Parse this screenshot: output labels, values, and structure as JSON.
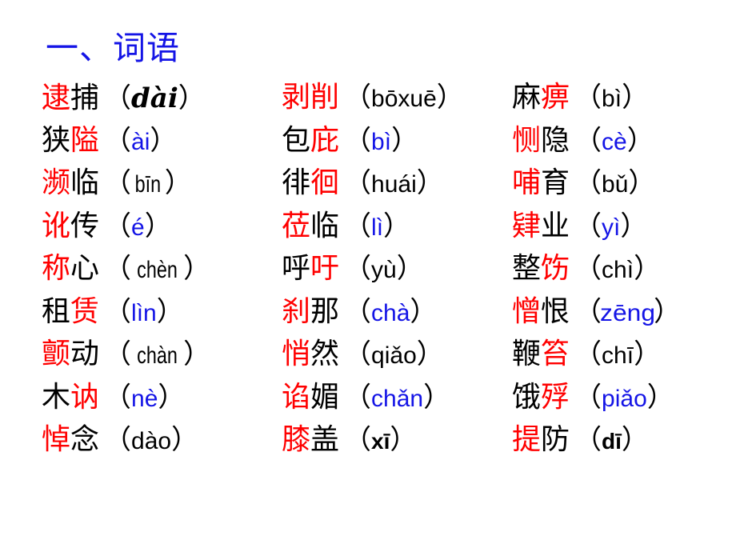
{
  "slide": {
    "title": "一、词语",
    "title_color": "#1414e6",
    "background": "#ffffff",
    "red": "#ff0000",
    "blue": "#1414e6",
    "black": "#000000",
    "open_paren": "（",
    "close_paren": "）"
  },
  "rows": [
    {
      "a": {
        "hz_red": "逮",
        "hz_black": "捕",
        "pinyin": "dài",
        "pinyin_color": "#000000",
        "style": "script"
      },
      "b": {
        "hz_red": "剥削",
        "hz_black": "",
        "pinyin": "bōxuē",
        "pinyin_color": "#000000",
        "style": "plain"
      },
      "c": {
        "hz_red": "",
        "hz_black": "麻",
        "hz_red2": "痹",
        "pinyin": "bì",
        "pinyin_color": "#000000",
        "style": "plain"
      }
    },
    {
      "a": {
        "hz_red": "",
        "hz_black": "狭",
        "hz_red2": "隘",
        "pinyin": "ài",
        "pinyin_color": "#1414e6",
        "style": "plain"
      },
      "b": {
        "hz_red": "",
        "hz_black": "包",
        "hz_red2": "庇",
        "pinyin": "bì",
        "pinyin_color": "#1414e6",
        "style": "plain"
      },
      "c": {
        "hz_red": "恻",
        "hz_black": "隐",
        "pinyin": "cè",
        "pinyin_color": "#1414e6",
        "style": "plain"
      }
    },
    {
      "a": {
        "hz_red": "濒",
        "hz_black": "临",
        "pinyin": "bīn",
        "pinyin_color": "#000000",
        "style": "narrow"
      },
      "b": {
        "hz_red": "",
        "hz_black": "徘",
        "hz_red2": "徊",
        "pinyin": "huái",
        "pinyin_color": "#000000",
        "style": "plain"
      },
      "c": {
        "hz_red": "哺",
        "hz_black": "育",
        "pinyin": "bǔ",
        "pinyin_color": "#000000",
        "style": "plain"
      }
    },
    {
      "a": {
        "hz_red": "讹",
        "hz_black": "传",
        "pinyin": "é",
        "pinyin_color": "#1414e6",
        "style": "plain"
      },
      "b": {
        "hz_red": "莅",
        "hz_black": "临",
        "pinyin": "lì",
        "pinyin_color": "#1414e6",
        "style": "plain"
      },
      "c": {
        "hz_red": "肄",
        "hz_black": "业",
        "pinyin": "yì",
        "pinyin_color": "#1414e6",
        "style": "plain"
      }
    },
    {
      "a": {
        "hz_red": "称",
        "hz_black": "心",
        "pinyin": "chèn",
        "pinyin_color": "#000000",
        "style": "narrow"
      },
      "b": {
        "hz_red": "",
        "hz_black": "呼",
        "hz_red2": "吁",
        "pinyin": "yù",
        "pinyin_color": "#000000",
        "style": "plain"
      },
      "c": {
        "hz_red": "",
        "hz_black": "整",
        "hz_red2": "饬",
        "pinyin": "chì",
        "pinyin_color": "#000000",
        "style": "plain"
      }
    },
    {
      "a": {
        "hz_red": "",
        "hz_black": "租",
        "hz_red2": "赁",
        "pinyin": "lìn",
        "pinyin_color": "#1414e6",
        "style": "plain"
      },
      "b": {
        "hz_red": "刹",
        "hz_black": "那",
        "pinyin": "chà",
        "pinyin_color": "#1414e6",
        "style": "plain"
      },
      "c": {
        "hz_red": "憎",
        "hz_black": "恨",
        "pinyin": "zēng",
        "pinyin_color": "#1414e6",
        "style": "wide"
      }
    },
    {
      "a": {
        "hz_red": "颤",
        "hz_black": "动",
        "pinyin": "chàn",
        "pinyin_color": "#000000",
        "style": "narrow"
      },
      "b": {
        "hz_red": "悄",
        "hz_black": "然",
        "pinyin": "qiǎo",
        "pinyin_color": "#000000",
        "style": "plain"
      },
      "c": {
        "hz_red": "",
        "hz_black": "鞭",
        "hz_red2": "笞",
        "pinyin": "chī",
        "pinyin_color": "#000000",
        "style": "plain"
      }
    },
    {
      "a": {
        "hz_red": "",
        "hz_black": "木",
        "hz_red2": "讷",
        "pinyin": "nè",
        "pinyin_color": "#1414e6",
        "style": "plain"
      },
      "b": {
        "hz_red": "谄",
        "hz_black": "媚",
        "pinyin": "chǎn",
        "pinyin_color": "#1414e6",
        "style": "plain"
      },
      "c": {
        "hz_red": "",
        "hz_black": "饿",
        "hz_red2": "殍",
        "pinyin": "piǎo",
        "pinyin_color": "#1414e6",
        "style": "plain"
      }
    },
    {
      "a": {
        "hz_red": "悼",
        "hz_black": "念",
        "pinyin": "dào",
        "pinyin_color": "#000000",
        "style": "plain"
      },
      "b": {
        "hz_red": "膝",
        "hz_black": "盖",
        "pinyin": "xī",
        "pinyin_color": "#000000",
        "style": "bold"
      },
      "c": {
        "hz_red": "提",
        "hz_black": "防",
        "pinyin": "dī",
        "pinyin_color": "#000000",
        "style": "bold"
      }
    }
  ]
}
